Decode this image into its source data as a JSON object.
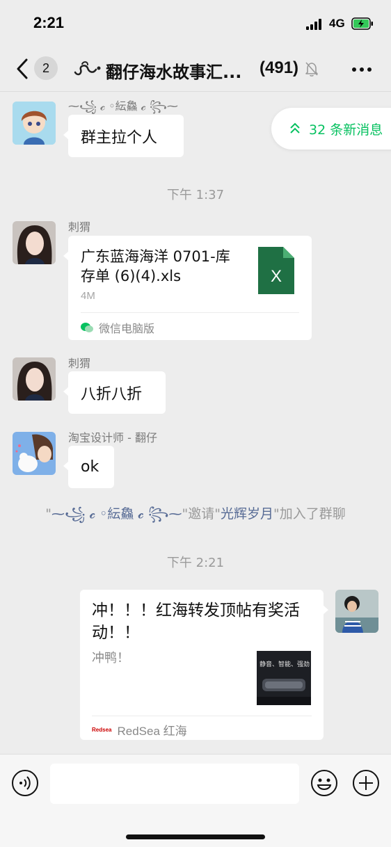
{
  "status_bar": {
    "time": "2:21",
    "network": "4G"
  },
  "nav": {
    "unread_count": "2",
    "title": "翻仔海水故事汇...",
    "member_count": "(491)"
  },
  "new_messages": {
    "label": "32 条新消息"
  },
  "messages": [
    {
      "sender": "⁓꧁ 𝓬 ◦紜鱻 𝓬 ꧂⁓",
      "text": "群主拉个人"
    },
    {
      "timestamp": "下午 1:37"
    },
    {
      "sender": "刺猬",
      "file_name": "广东蓝海海洋 0701-库存单 (6)(4).xls",
      "file_size": "4M",
      "file_source": "微信电脑版",
      "file_icon_letter": "X"
    },
    {
      "sender": "刺猬",
      "text": "八折八折"
    },
    {
      "sender": "淘宝设计师 - 翻仔",
      "text": "ok"
    },
    {
      "system_prefix": "\"",
      "system_inviter": "⁓꧁ 𝓬 ◦紜鱻 𝓬 ꧂⁓",
      "system_mid": "\"邀请\"",
      "system_invitee": "光辉岁月",
      "system_suffix": "\"加入了群聊"
    },
    {
      "timestamp": "下午 2:21"
    },
    {
      "link_title": "冲！！！红海转发顶帖有奖活动！！",
      "link_desc": "冲鸭！",
      "thumb_text": "静音、智能、强劲",
      "link_source": "RedSea 红海",
      "link_source_logo": "Redsea"
    }
  ],
  "colors": {
    "accent_green": "#07c160",
    "link_blue": "#576b95",
    "background": "#ededed"
  }
}
